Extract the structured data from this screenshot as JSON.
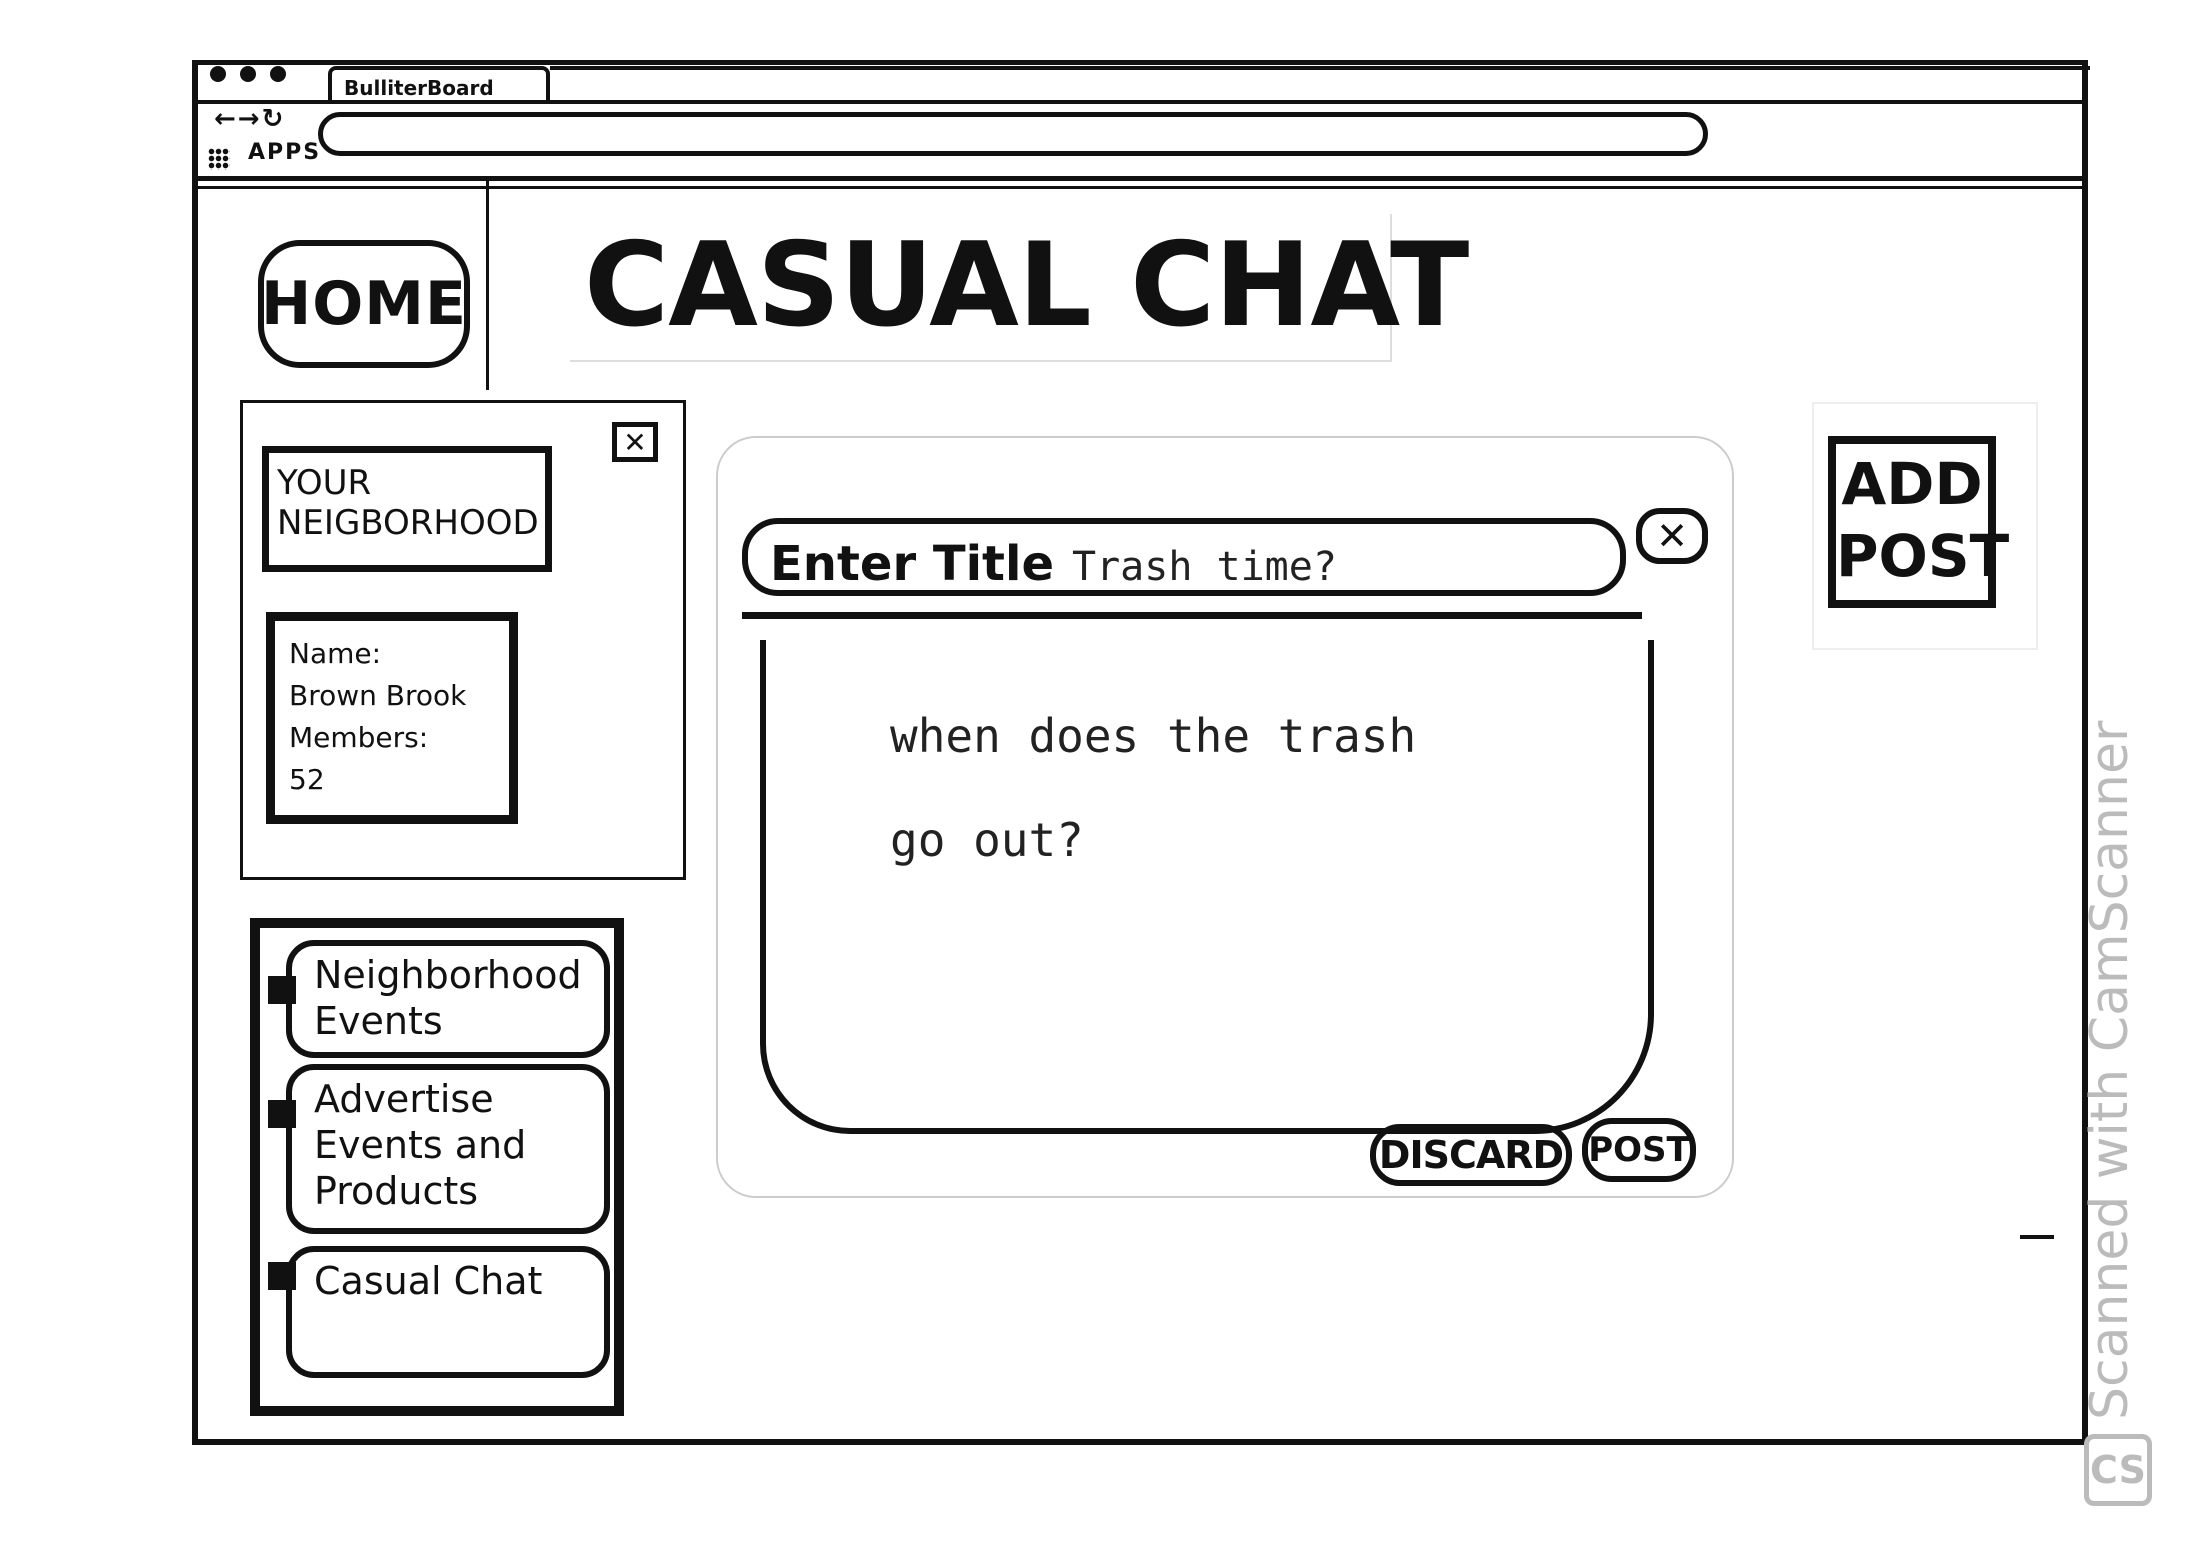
{
  "browser": {
    "tab_title": "BulliterBoard",
    "nav_glyphs": "←→↻",
    "apps_label": "APPS"
  },
  "sidebar": {
    "home_label": "HOME",
    "neighborhood": {
      "header": "YOUR NEIGBORHOOD",
      "close_glyph": "✕",
      "name_label": "Name:",
      "name_value": "Brown Brook",
      "members_label": "Members:",
      "members_value": "52"
    },
    "nav_items": [
      {
        "label": "Neighborhood Events"
      },
      {
        "label": "Advertise Events and Products"
      },
      {
        "label": "Casual Chat"
      }
    ]
  },
  "header": {
    "title": "CASUAL CHAT"
  },
  "post_dialog": {
    "title_label": "Enter Title",
    "title_value": "Trash time?",
    "close_glyph": "✕",
    "body_value": "when does the trash\ngo out?",
    "discard_label": "DISCARD",
    "post_label": "POST"
  },
  "add_post": {
    "label": "ADD POST"
  },
  "watermark": {
    "text": "Scanned with CamScanner",
    "logo": "CS"
  }
}
